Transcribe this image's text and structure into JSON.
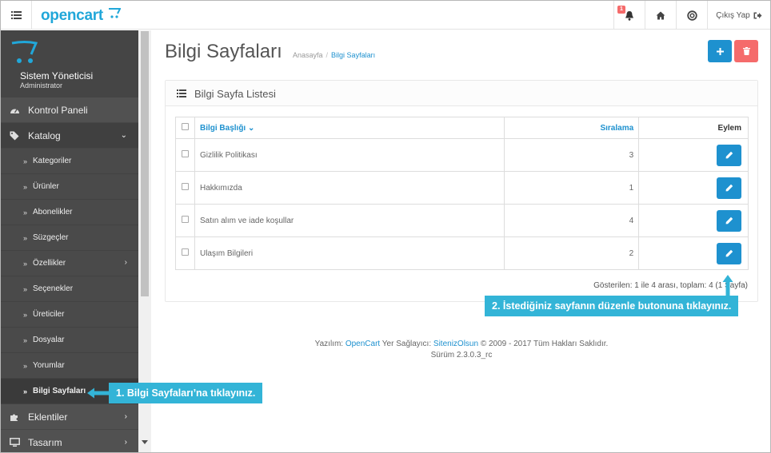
{
  "header": {
    "logo_text": "opencart",
    "notification_count": "1",
    "logout_label": "Çıkış Yap"
  },
  "sidebar": {
    "user_name": "Sistem Yöneticisi",
    "user_role": "Administrator",
    "items": [
      {
        "label": "Kontrol Paneli",
        "icon": "dashboard-icon"
      },
      {
        "label": "Katalog",
        "icon": "tags-icon",
        "expanded": true
      },
      {
        "label": "Eklentiler",
        "icon": "puzzle-icon"
      },
      {
        "label": "Tasarım",
        "icon": "monitor-icon"
      }
    ],
    "subitems": [
      {
        "label": "Kategoriler"
      },
      {
        "label": "Ürünler"
      },
      {
        "label": "Abonelikler"
      },
      {
        "label": "Süzgeçler"
      },
      {
        "label": "Özellikler"
      },
      {
        "label": "Seçenekler"
      },
      {
        "label": "Üreticiler"
      },
      {
        "label": "Dosyalar"
      },
      {
        "label": "Yorumlar"
      },
      {
        "label": "Bilgi Sayfaları",
        "active": true
      }
    ]
  },
  "page": {
    "title": "Bilgi Sayfaları",
    "breadcrumb": [
      "Anasayfa",
      "Bilgi Sayfaları"
    ]
  },
  "panel": {
    "title": "Bilgi Sayfa Listesi",
    "columns": {
      "title": "Bilgi Başlığı",
      "sort": "Sıralama",
      "action": "Eylem"
    },
    "rows": [
      {
        "title": "Gizlilik Politikası",
        "sort": "3"
      },
      {
        "title": "Hakkımızda",
        "sort": "1"
      },
      {
        "title": "Satın alım ve iade koşullar",
        "sort": "4"
      },
      {
        "title": "Ulaşım Bilgileri",
        "sort": "2"
      }
    ],
    "showing": "Gösterilen: 1 ile 4 arası, toplam: 4 (1 Sayfa)"
  },
  "footer": {
    "line1_prefix": "Yazılım: ",
    "software_link": "OpenCart",
    "line1_mid": " Yer Sağlayıcı: ",
    "host_link": "SitenizOlsun",
    "line1_suffix": " © 2009 - 2017 Tüm Hakları Saklıdır.",
    "version": "Sürüm 2.3.0.3_rc"
  },
  "callouts": {
    "step1": "1. Bilgi Sayfaları’na tıklayınız.",
    "step2": "2. İstediğiniz sayfanın düzenle butonuna tıklayınız."
  },
  "colors": {
    "accent": "#1e91cf",
    "danger": "#f56b6b",
    "sidebar": "#515151",
    "callout": "#33b4d7"
  }
}
